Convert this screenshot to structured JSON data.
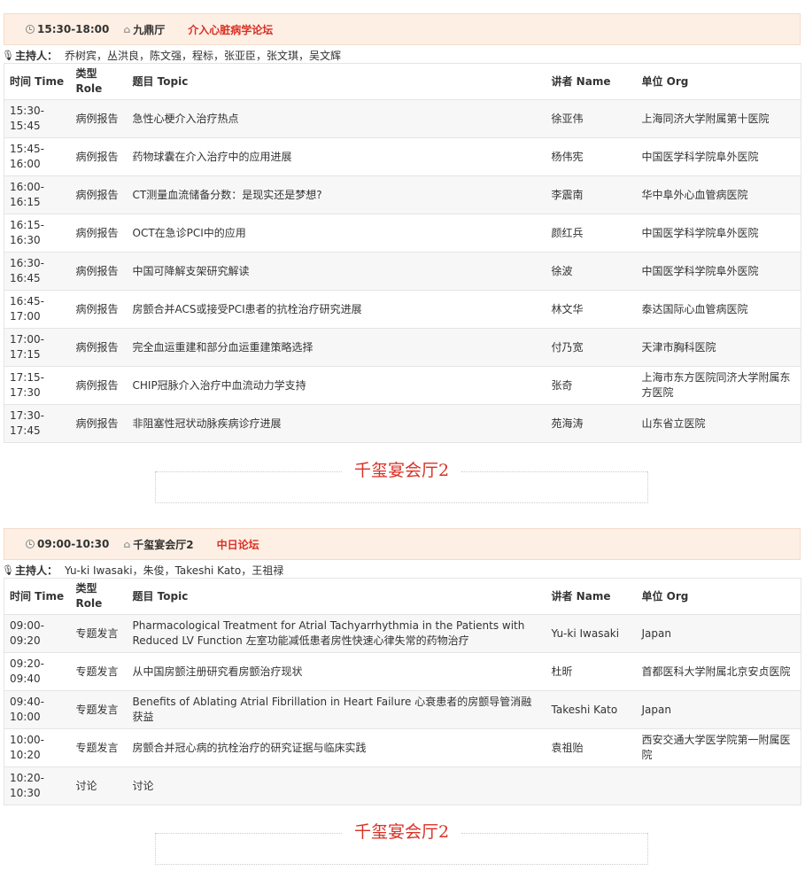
{
  "session1": {
    "time": "15:30-18:00",
    "room": "九鼎厅",
    "forum": "介入心脏病学论坛",
    "host_label": "主持人：",
    "hosts": "乔树宾，丛洪良，陈文强，程标，张亚臣，张文琪，吴文辉",
    "headers": {
      "time": "时间 Time",
      "role": "类型 Role",
      "topic": "题目 Topic",
      "speaker": "讲者 Name",
      "org": "单位 Org"
    },
    "rows": [
      {
        "time": "15:30-15:45",
        "role": "病例报告",
        "topic": "急性心梗介入治疗热点",
        "speaker": "徐亚伟",
        "org": "上海同济大学附属第十医院"
      },
      {
        "time": "15:45-16:00",
        "role": "病例报告",
        "topic": "药物球囊在介入治疗中的应用进展",
        "speaker": "杨伟宪",
        "org": "中国医学科学院阜外医院"
      },
      {
        "time": "16:00-16:15",
        "role": "病例报告",
        "topic": "CT测量血流储备分数：是现实还是梦想?",
        "speaker": "李震南",
        "org": "华中阜外心血管病医院"
      },
      {
        "time": "16:15-16:30",
        "role": "病例报告",
        "topic": "OCT在急诊PCI中的应用",
        "speaker": "颜红兵",
        "org": "中国医学科学院阜外医院"
      },
      {
        "time": "16:30-16:45",
        "role": "病例报告",
        "topic": "中国可降解支架研究解读",
        "speaker": "徐波",
        "org": "中国医学科学院阜外医院"
      },
      {
        "time": "16:45-17:00",
        "role": "病例报告",
        "topic": "房颤合并ACS或接受PCI患者的抗栓治疗研究进展",
        "speaker": "林文华",
        "org": "泰达国际心血管病医院"
      },
      {
        "time": "17:00-17:15",
        "role": "病例报告",
        "topic": "完全血运重建和部分血运重建策略选择",
        "speaker": "付乃宽",
        "org": "天津市胸科医院"
      },
      {
        "time": "17:15-17:30",
        "role": "病例报告",
        "topic": "CHIP冠脉介入治疗中血流动力学支持",
        "speaker": "张奇",
        "org": "上海市东方医院同济大学附属东方医院"
      },
      {
        "time": "17:30-17:45",
        "role": "病例报告",
        "topic": "非阻塞性冠状动脉疾病诊疗进展",
        "speaker": "苑海涛",
        "org": "山东省立医院"
      }
    ]
  },
  "banner1": {
    "title": "千玺宴会厅2"
  },
  "session2": {
    "time": "09:00-10:30",
    "room": "千玺宴会厅2",
    "forum": "中日论坛",
    "host_label": "主持人：",
    "hosts": "Yu-ki Iwasaki，朱俊，Takeshi Kato，王祖禄",
    "headers": {
      "time": "时间 Time",
      "role": "类型 Role",
      "topic": "题目 Topic",
      "speaker": "讲者 Name",
      "org": "单位 Org"
    },
    "rows": [
      {
        "time": "09:00-09:20",
        "role": "专题发言",
        "topic": "Pharmacological Treatment for Atrial Tachyarrhythmia in the Patients with Reduced LV Function 左室功能减低患者房性快速心律失常的药物治疗",
        "speaker": "Yu-ki Iwasaki",
        "org": "Japan"
      },
      {
        "time": "09:20-09:40",
        "role": "专题发言",
        "topic": "从中国房颤注册研究看房颤治疗现状",
        "speaker": "杜昕",
        "org": "首都医科大学附属北京安贞医院"
      },
      {
        "time": "09:40-10:00",
        "role": "专题发言",
        "topic": "Benefits of Ablating Atrial Fibrillation in Heart Failure 心衰患者的房颤导管消融获益",
        "speaker": "Takeshi Kato",
        "org": "Japan"
      },
      {
        "time": "10:00-10:20",
        "role": "专题发言",
        "topic": "房颤合并冠心病的抗栓治疗的研究证据与临床实践",
        "speaker": "袁祖贻",
        "org": "西安交通大学医学院第一附属医院"
      },
      {
        "time": "10:20-10:30",
        "role": "讨论",
        "topic": "讨论",
        "speaker": "",
        "org": ""
      }
    ]
  },
  "banner2": {
    "title": "千玺宴会厅2"
  }
}
